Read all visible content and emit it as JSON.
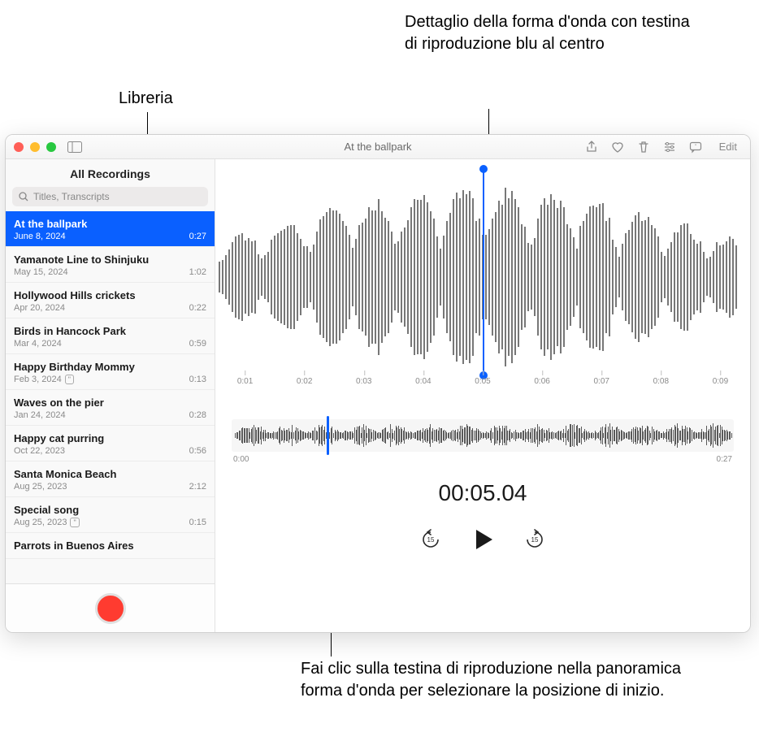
{
  "callouts": {
    "library": "Libreria",
    "detail": "Dettaglio della forma d'onda con testina di riproduzione blu al centro",
    "overview": "Fai clic sulla testina di riproduzione nella panoramica forma d'onda per selezionare la posizione di inizio."
  },
  "titlebar": {
    "title": "At the ballpark",
    "edit": "Edit"
  },
  "sidebar": {
    "header": "All Recordings",
    "search_placeholder": "Titles, Transcripts",
    "items": [
      {
        "title": "At the ballpark",
        "date": "June 8, 2024",
        "dur": "0:27",
        "sel": true,
        "transcript": false
      },
      {
        "title": "Yamanote Line to Shinjuku",
        "date": "May 15, 2024",
        "dur": "1:02",
        "sel": false,
        "transcript": false
      },
      {
        "title": "Hollywood Hills crickets",
        "date": "Apr 20, 2024",
        "dur": "0:22",
        "sel": false,
        "transcript": false
      },
      {
        "title": "Birds in Hancock Park",
        "date": "Mar 4, 2024",
        "dur": "0:59",
        "sel": false,
        "transcript": false
      },
      {
        "title": "Happy Birthday Mommy",
        "date": "Feb 3, 2024",
        "dur": "0:13",
        "sel": false,
        "transcript": true
      },
      {
        "title": "Waves on the pier",
        "date": "Jan 24, 2024",
        "dur": "0:28",
        "sel": false,
        "transcript": false
      },
      {
        "title": "Happy cat purring",
        "date": "Oct 22, 2023",
        "dur": "0:56",
        "sel": false,
        "transcript": false
      },
      {
        "title": "Santa Monica Beach",
        "date": "Aug 25, 2023",
        "dur": "2:12",
        "sel": false,
        "transcript": false
      },
      {
        "title": "Special song",
        "date": "Aug 25, 2023",
        "dur": "0:15",
        "sel": false,
        "transcript": true
      },
      {
        "title": "Parrots in Buenos Aires",
        "date": "",
        "dur": "",
        "sel": false,
        "transcript": false
      }
    ]
  },
  "timeline": {
    "ticks": [
      "0:01",
      "0:02",
      "0:03",
      "0:04",
      "0:05",
      "0:06",
      "0:07",
      "0:08",
      "0:09"
    ],
    "playhead_pct_detail": 50,
    "playhead_pct_overview": 19
  },
  "overview": {
    "start": "0:00",
    "end": "0:27"
  },
  "current_time": "00:05.04",
  "skip_label": "15"
}
